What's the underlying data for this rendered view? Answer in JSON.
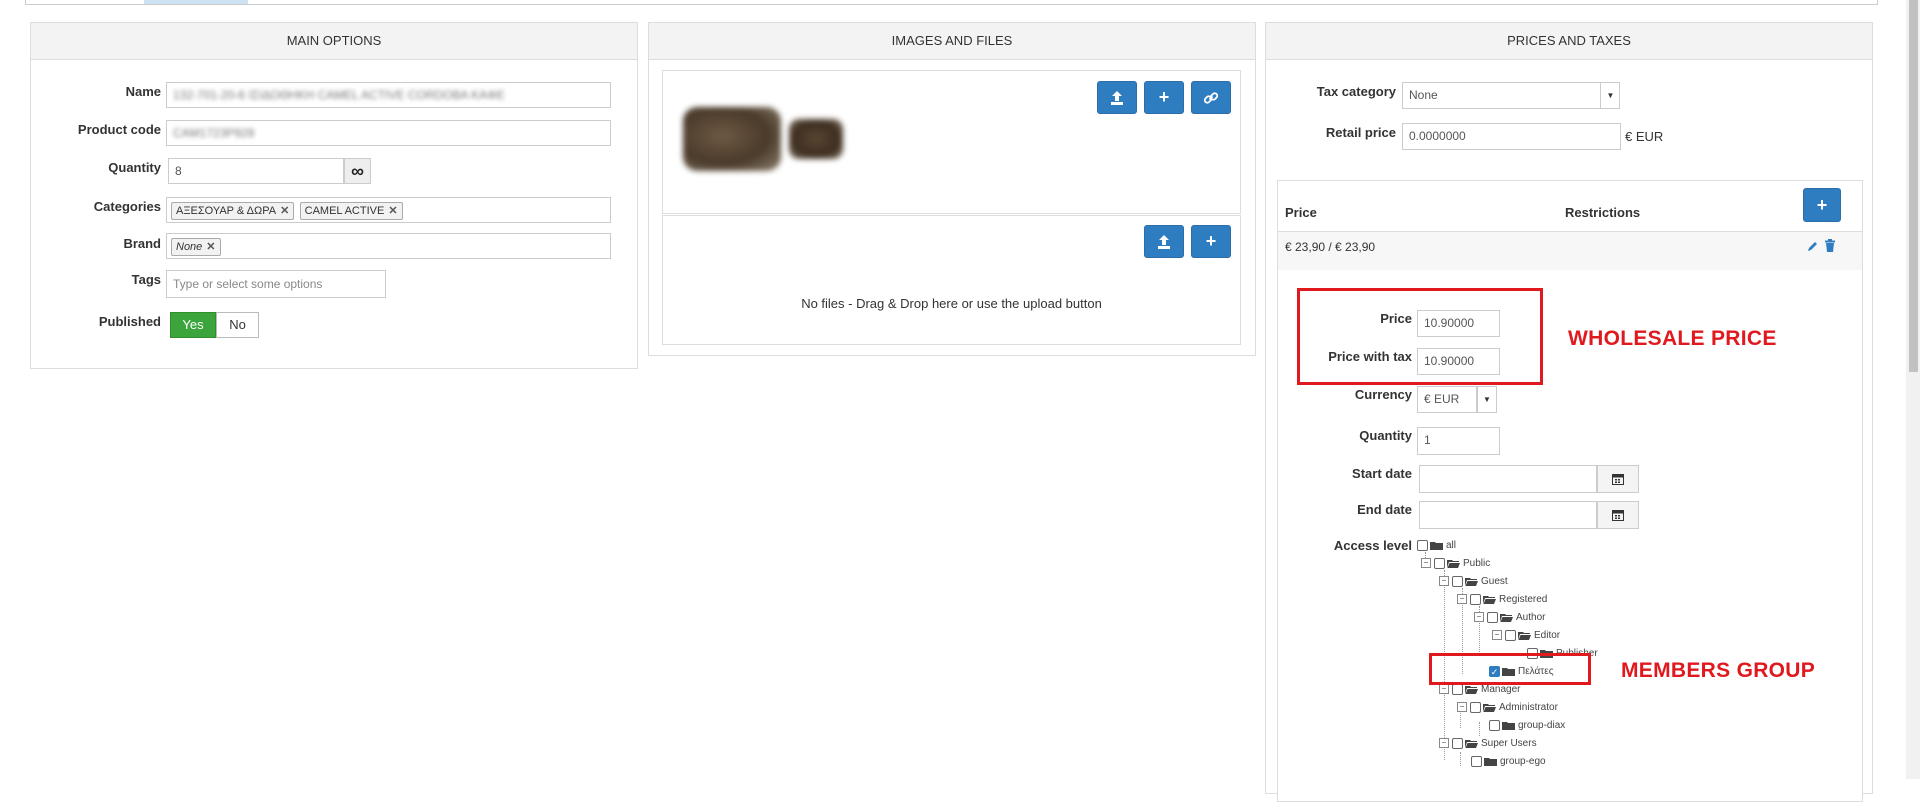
{
  "main_options": {
    "header": "MAIN OPTIONS",
    "name_label": "Name",
    "name_value": "132-701-20-6 ΙΣΙΔΟΘΗΚΗ CAMEL ACTIVE CORDOBA KAΦE",
    "product_code_label": "Product code",
    "product_code_value": "CAM1723P928",
    "quantity_label": "Quantity",
    "quantity_value": "8",
    "categories_label": "Categories",
    "categories": [
      "ΑΞΕΣΟΥΑΡ & ΔΩΡΑ",
      "CAMEL ACTIVE"
    ],
    "brand_label": "Brand",
    "brand_value": "None",
    "tags_label": "Tags",
    "tags_placeholder": "Type or select some options",
    "published_label": "Published",
    "published_yes": "Yes",
    "published_no": "No"
  },
  "images_files": {
    "header": "IMAGES AND FILES",
    "no_files_text": "No files - Drag & Drop here or use the upload button"
  },
  "prices_taxes": {
    "header": "PRICES AND TAXES",
    "tax_category_label": "Tax category",
    "tax_category_value": "None",
    "retail_price_label": "Retail price",
    "retail_price_value": "0.0000000",
    "retail_currency": "€ EUR",
    "table_col_price": "Price",
    "table_col_restrictions": "Restrictions",
    "price_row_value": "€ 23,90 / € 23,90",
    "price_label": "Price",
    "price_value": "10.90000",
    "price_with_tax_label": "Price with tax",
    "price_with_tax_value": "10.90000",
    "currency_label": "Currency",
    "currency_value": "€ EUR",
    "quantity_label": "Quantity",
    "quantity_value": "1",
    "start_date_label": "Start date",
    "end_date_label": "End date",
    "access_level_label": "Access level"
  },
  "access_tree": [
    "all",
    "Public",
    "Guest",
    "Registered",
    "Author",
    "Editor",
    "Publisher",
    "Πελάτες",
    "Manager",
    "Administrator",
    "group-diax",
    "Super Users",
    "group-ego"
  ],
  "annotations": {
    "wholesale": "WHOLESALE PRICE",
    "members": "MEMBERS GROUP"
  },
  "colors": {
    "accent_blue": "#2f7dc1",
    "published_green": "#3ba53b",
    "annotation_red": "#e0191f"
  }
}
